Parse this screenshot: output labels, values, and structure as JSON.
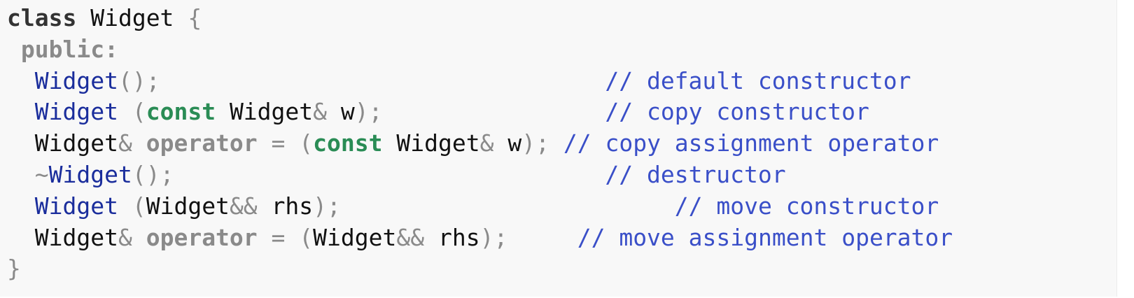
{
  "code": {
    "line1": {
      "keyword": "class",
      "name": "Widget",
      "open_brace": "{"
    },
    "line2": {
      "access": "public:"
    },
    "line3": {
      "fn": "Widget",
      "parens": "();",
      "comment": "// default constructor"
    },
    "line4": {
      "fn": "Widget",
      "paren_open": "(",
      "kw_const": "const",
      "type": "Widget",
      "amp": "&",
      "param": "w",
      "close": ");",
      "comment": "// copy constructor"
    },
    "line5": {
      "type": "Widget",
      "amp": "&",
      "operator": "operator",
      "eq": "=",
      "paren_open": "(",
      "kw_const": "const",
      "type2": "Widget",
      "amp2": "&",
      "param": "w",
      "close": ");",
      "comment": "// copy assignment operator"
    },
    "line6": {
      "tilde": "~",
      "fn": "Widget",
      "parens": "();",
      "comment": "// destructor"
    },
    "line7": {
      "fn": "Widget",
      "paren_open": "(",
      "type": "Widget",
      "amp": "&&",
      "param": "rhs",
      "close": ");",
      "comment": "// move constructor"
    },
    "line8": {
      "type": "Widget",
      "amp": "&",
      "operator": "operator",
      "eq": "=",
      "paren_open": "(",
      "type2": "Widget",
      "amp2": "&&",
      "param": "rhs",
      "close": ");",
      "comment": "// move assignment operator"
    },
    "line9": {
      "close_brace": "}"
    }
  }
}
